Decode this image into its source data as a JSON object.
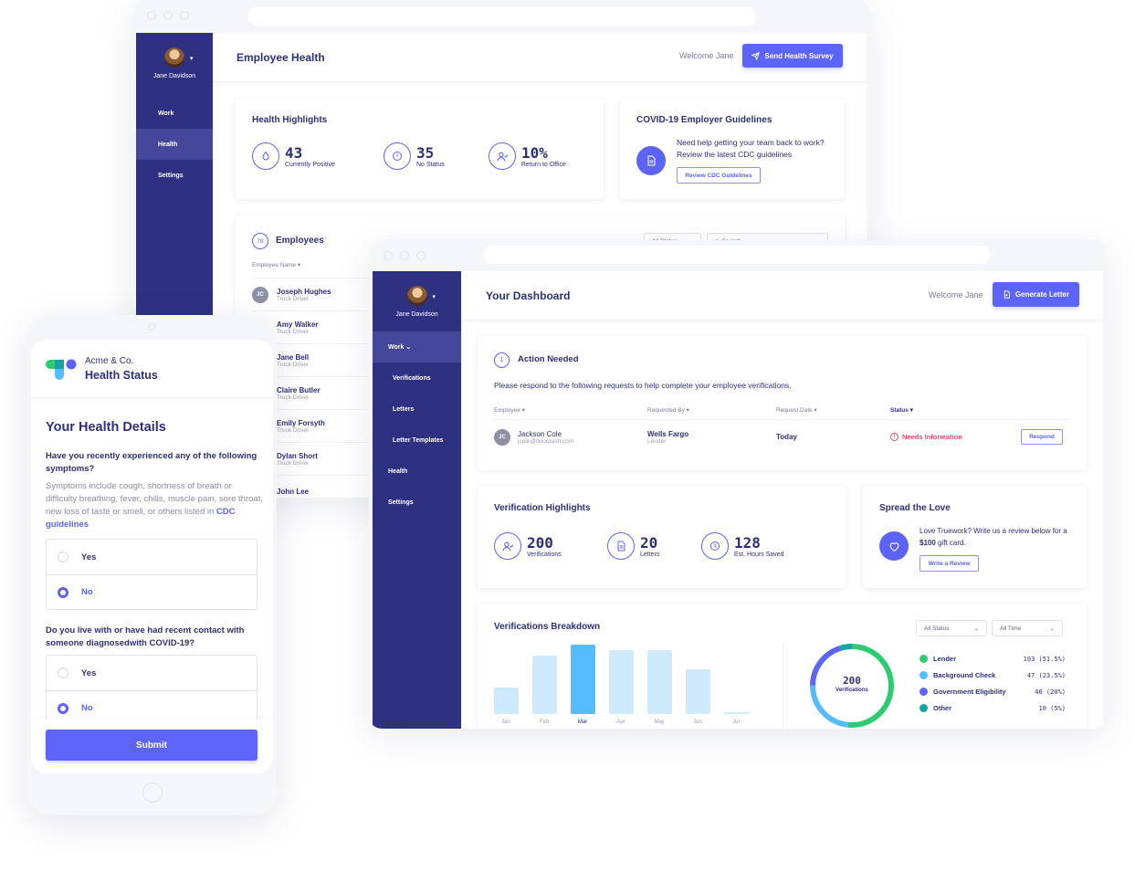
{
  "colors": {
    "sidebar": "#2e3182",
    "primary": "#5c63f7",
    "lender": "#2ecc71",
    "background_check": "#55bdff",
    "government": "#5c63f7",
    "other": "#14a3a0",
    "danger": "#f0456e"
  },
  "health_window": {
    "sidebar": {
      "user_name": "Jane Davidson",
      "items": [
        {
          "label": "Work",
          "active": false
        },
        {
          "label": "Health",
          "active": true
        },
        {
          "label": "Settings",
          "active": false
        }
      ]
    },
    "header": {
      "title": "Employee Health",
      "welcome": "Welcome Jane",
      "action_label": "Send Health Survey",
      "action_icon": "send-icon"
    },
    "highlights": {
      "title": "Health Highlights",
      "stats": [
        {
          "value": "43",
          "label": "Currently Positive",
          "icon": "droplet-icon"
        },
        {
          "value": "35",
          "label": "No Status",
          "icon": "alert-icon"
        },
        {
          "value": "10%",
          "label": "Return to Office",
          "icon": "user-check-icon"
        }
      ]
    },
    "guidelines": {
      "title": "COVID-19 Employer Guidelines",
      "text": "Need help getting your team back to work? Review the latest CDC guidelines",
      "button_label": "Review CDC Guidelines",
      "icon": "document-icon"
    },
    "employees": {
      "count": "78",
      "title": "Employees",
      "status_filter": "All Status",
      "search_placeholder": "Search",
      "column_header": "Employee Name",
      "rows": [
        {
          "initials": "JC",
          "name": "Joseph Hughes",
          "role": "Truck Driver"
        },
        {
          "initials": "",
          "name": "Amy Walker",
          "role": "Truck Driver"
        },
        {
          "initials": "",
          "name": "Jane Bell",
          "role": "Truck Driver"
        },
        {
          "initials": "",
          "name": "Claire Butler",
          "role": "Truck Driver"
        },
        {
          "initials": "",
          "name": "Emily Forsyth",
          "role": "Truck Driver"
        },
        {
          "initials": "",
          "name": "Dylan Short",
          "role": "Truck Driver"
        },
        {
          "initials": "",
          "name": "John Lee",
          "role": ""
        }
      ]
    }
  },
  "dashboard_window": {
    "sidebar": {
      "user_name": "Jane Davidson",
      "items": [
        {
          "label": "Work",
          "active": true,
          "sub": false,
          "expanded": true
        },
        {
          "label": "Verifications",
          "active": false,
          "sub": true
        },
        {
          "label": "Letters",
          "active": false,
          "sub": true
        },
        {
          "label": "Letter Templates",
          "active": false,
          "sub": true
        },
        {
          "label": "Health",
          "active": false,
          "sub": false
        },
        {
          "label": "Settings",
          "active": false,
          "sub": false
        }
      ]
    },
    "header": {
      "title": "Your Dashboard",
      "welcome": "Welcome Jane",
      "action_label": "Generate Letter",
      "action_icon": "file-plus-icon"
    },
    "action_needed": {
      "count": "1",
      "title": "Action Needed",
      "description": "Please respond to the following requests to help complete your employee verifications.",
      "columns": [
        "Employee",
        "Requested By",
        "Request Date",
        "Status"
      ],
      "rows": [
        {
          "initials": "JC",
          "employee": "Jackson Cole",
          "email": "jcole@doordash.com",
          "requested_by": "Wells Fargo",
          "requester_type": "Lender",
          "date": "Today",
          "status": "Needs Information",
          "action_label": "Respond"
        }
      ]
    },
    "verification_highlights": {
      "title": "Verification Highlights",
      "stats": [
        {
          "value": "200",
          "label": "Verifications",
          "icon": "user-check-icon"
        },
        {
          "value": "20",
          "label": "Letters",
          "icon": "document-icon"
        },
        {
          "value": "128",
          "label": "Est. Hours Saved",
          "icon": "clock-icon"
        }
      ]
    },
    "spread_love": {
      "title": "Spread the Love",
      "text_before": "Love Truework? Write us a review below for a ",
      "text_bold": "$100",
      "text_after": " gift card.",
      "button_label": "Write a Review",
      "icon": "heart-icon"
    },
    "breakdown": {
      "title": "Verifications Breakdown",
      "status_filter": "All Status",
      "time_filter": "All Time",
      "donut_total": "200",
      "donut_label": "Verifications"
    }
  },
  "phone": {
    "company": "Acme & Co.",
    "title": "Health Status",
    "section_title": "Your Health Details",
    "q1": {
      "question": "Have you recently experienced any of the following symptoms?",
      "help_text": "Symptoms include cough, shortness of breath or difficulty breathing, fever, chills, muscle pain, sore throat, new loss of taste or smell, or others listed in ",
      "help_link": "CDC guidelines",
      "options": [
        "Yes",
        "No"
      ],
      "selected": "No"
    },
    "q2": {
      "question": "Do you live with or have had recent contact with someone diagnosedwith COVID-19?",
      "options": [
        "Yes",
        "No"
      ],
      "selected": "No"
    },
    "submit_label": "Submit"
  },
  "chart_data": [
    {
      "type": "bar",
      "title": "Verifications Breakdown",
      "categories": [
        "Jan",
        "Feb",
        "Mar",
        "Apr",
        "May",
        "Jun",
        "Jul"
      ],
      "values": [
        28,
        62,
        74,
        68,
        68,
        48,
        2
      ],
      "highlighted": "Mar",
      "xlabel": "",
      "ylabel": "",
      "ylim": [
        0,
        80
      ],
      "grid": false
    },
    {
      "type": "pie",
      "title": "Verifications",
      "total": 200,
      "series": [
        {
          "name": "Lender",
          "value": 103,
          "percent": "51.5%",
          "color": "#2ecc71"
        },
        {
          "name": "Background Check",
          "value": 47,
          "percent": "23.5%",
          "color": "#55bdff"
        },
        {
          "name": "Government Eligibility",
          "value": 40,
          "percent": "20%",
          "color": "#5c63f7"
        },
        {
          "name": "Other",
          "value": 10,
          "percent": "5%",
          "color": "#14a3a0"
        }
      ],
      "legend": "right"
    }
  ]
}
